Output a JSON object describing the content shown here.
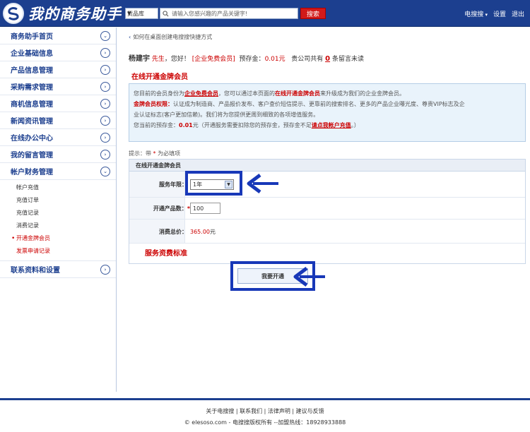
{
  "header": {
    "logo_text": "我的商务助手",
    "search_category": "货品库",
    "search_placeholder": "请输入您感兴趣的产品关键字!",
    "search_button": "搜索",
    "links": [
      "电搜搜",
      "设置",
      "退出"
    ]
  },
  "sidebar": {
    "items": [
      {
        "label": "商务助手首页",
        "icon": "chevron-down-icon"
      },
      {
        "label": "企业基础信息",
        "icon": "chevron-right-icon"
      },
      {
        "label": "产品信息管理",
        "icon": "chevron-right-icon"
      },
      {
        "label": "采购需求管理",
        "icon": "chevron-right-icon"
      },
      {
        "label": "商机信息管理",
        "icon": "chevron-right-icon"
      },
      {
        "label": "新闻资讯管理",
        "icon": "chevron-right-icon"
      },
      {
        "label": "在线办公中心",
        "icon": "chevron-right-icon"
      },
      {
        "label": "我的留言管理",
        "icon": "chevron-right-icon"
      },
      {
        "label": "帐户财务管理",
        "icon": "chevron-down-icon"
      }
    ],
    "sub_items": [
      "帐户充值",
      "充值订单",
      "充值记录",
      "消费记录",
      "开通金牌会员",
      "发票申请记录"
    ],
    "last_item": {
      "label": "联系资料和设置",
      "icon": "chevron-right-icon"
    }
  },
  "main": {
    "breadcrumb": "如何在桌面创建电搜搜快捷方式",
    "user": {
      "name": "杨建宇",
      "title": "先生",
      "greeting": "，您好！",
      "member": "[企业免费会员]",
      "deposit_label": "预存金：",
      "deposit_value": "0.01元",
      "msg_prefix": "贵公司共有",
      "msg_count": "0",
      "msg_suffix": "条留言未读"
    },
    "section_title": "在线开通金牌会员",
    "info": {
      "line1_a": "您目前的会员身份为",
      "line1_b": "企业免费会员",
      "line1_c": "，您可以通过本页面的",
      "line1_d": "在线开通金牌会员",
      "line1_e": "来升级成为我们的企业金牌会员。",
      "line2_a": "金牌会员权限：",
      "line2_b": "认证成为制造商、产品报价发布、客户查价短信提示、更靠前的搜索排名、更多的产品企业曝光度、尊贵VIP标志及企",
      "line3": "业认证标志(客户更加信赖)。我们将为您提供更周到细致的各项增值服务。",
      "line4_a": "您当前的预存金：",
      "line4_b": "0.01",
      "line4_c": "元（开通服务需要扣除您的预存金，预存金不足",
      "line4_d": "请点我帐户充值",
      "line4_e": "。）"
    },
    "hint_a": "提示：带",
    "hint_star": "*",
    "hint_b": "为必填项",
    "form": {
      "title": "在线开通金牌会员",
      "years_label": "服务年限：",
      "years_value": "1年",
      "products_label": "开通产品数：",
      "products_star": "*",
      "products_value": "100",
      "total_label": "消费总价：",
      "total_value": "365.00",
      "total_unit": "元",
      "standard_link": "服务资费标准",
      "submit": "我要开通"
    }
  },
  "footer": {
    "links": "关于电搜搜 | 联系我们 | 法律声明 | 建议与反馈",
    "copyright": "© elesoso.com - 电搜搜版权所有 --加盟热线：18928933888"
  }
}
